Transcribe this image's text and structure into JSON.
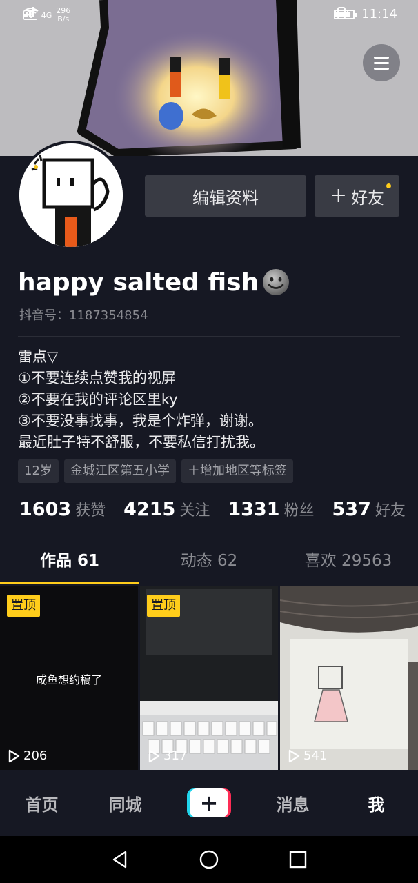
{
  "status_bar": {
    "hd_label": "HD",
    "network": "4G",
    "speed_value": "296",
    "speed_unit": "B/s",
    "time": "11:14"
  },
  "profile": {
    "nickname": "happy salted fish",
    "douyin_id": "抖音号：1187354854",
    "edit_button": "编辑资料",
    "add_friend_button": "好友",
    "bio_lines": [
      "雷点▽",
      "①不要连续点赞我的视屏",
      "②不要在我的评论区里ky",
      "③不要没事找事，我是个炸弹，谢谢。",
      "最近肚子特不舒服，不要私信打扰我。"
    ],
    "tags": [
      "12岁",
      "金城江区第五小学",
      "＋增加地区等标签"
    ]
  },
  "stats": [
    {
      "value": "1603",
      "label": "获赞"
    },
    {
      "value": "4215",
      "label": "关注"
    },
    {
      "value": "1331",
      "label": "粉丝"
    },
    {
      "value": "537",
      "label": "好友"
    }
  ],
  "tabs": [
    {
      "label": "作品 61"
    },
    {
      "label": "动态 62"
    },
    {
      "label": "喜欢 29563"
    }
  ],
  "videos": [
    {
      "pinned_label": "置顶",
      "plays": "206",
      "caption": "咸鱼想约稿了"
    },
    {
      "pinned_label": "置顶",
      "plays": "317"
    },
    {
      "plays": "541"
    }
  ],
  "bottom_nav": {
    "home": "首页",
    "nearby": "同城",
    "add": "+",
    "messages": "消息",
    "me": "我"
  },
  "colors": {
    "background": "#161823",
    "accent": "#ffcd1b",
    "button": "#393b44",
    "muted_text": "#8a8b91"
  }
}
